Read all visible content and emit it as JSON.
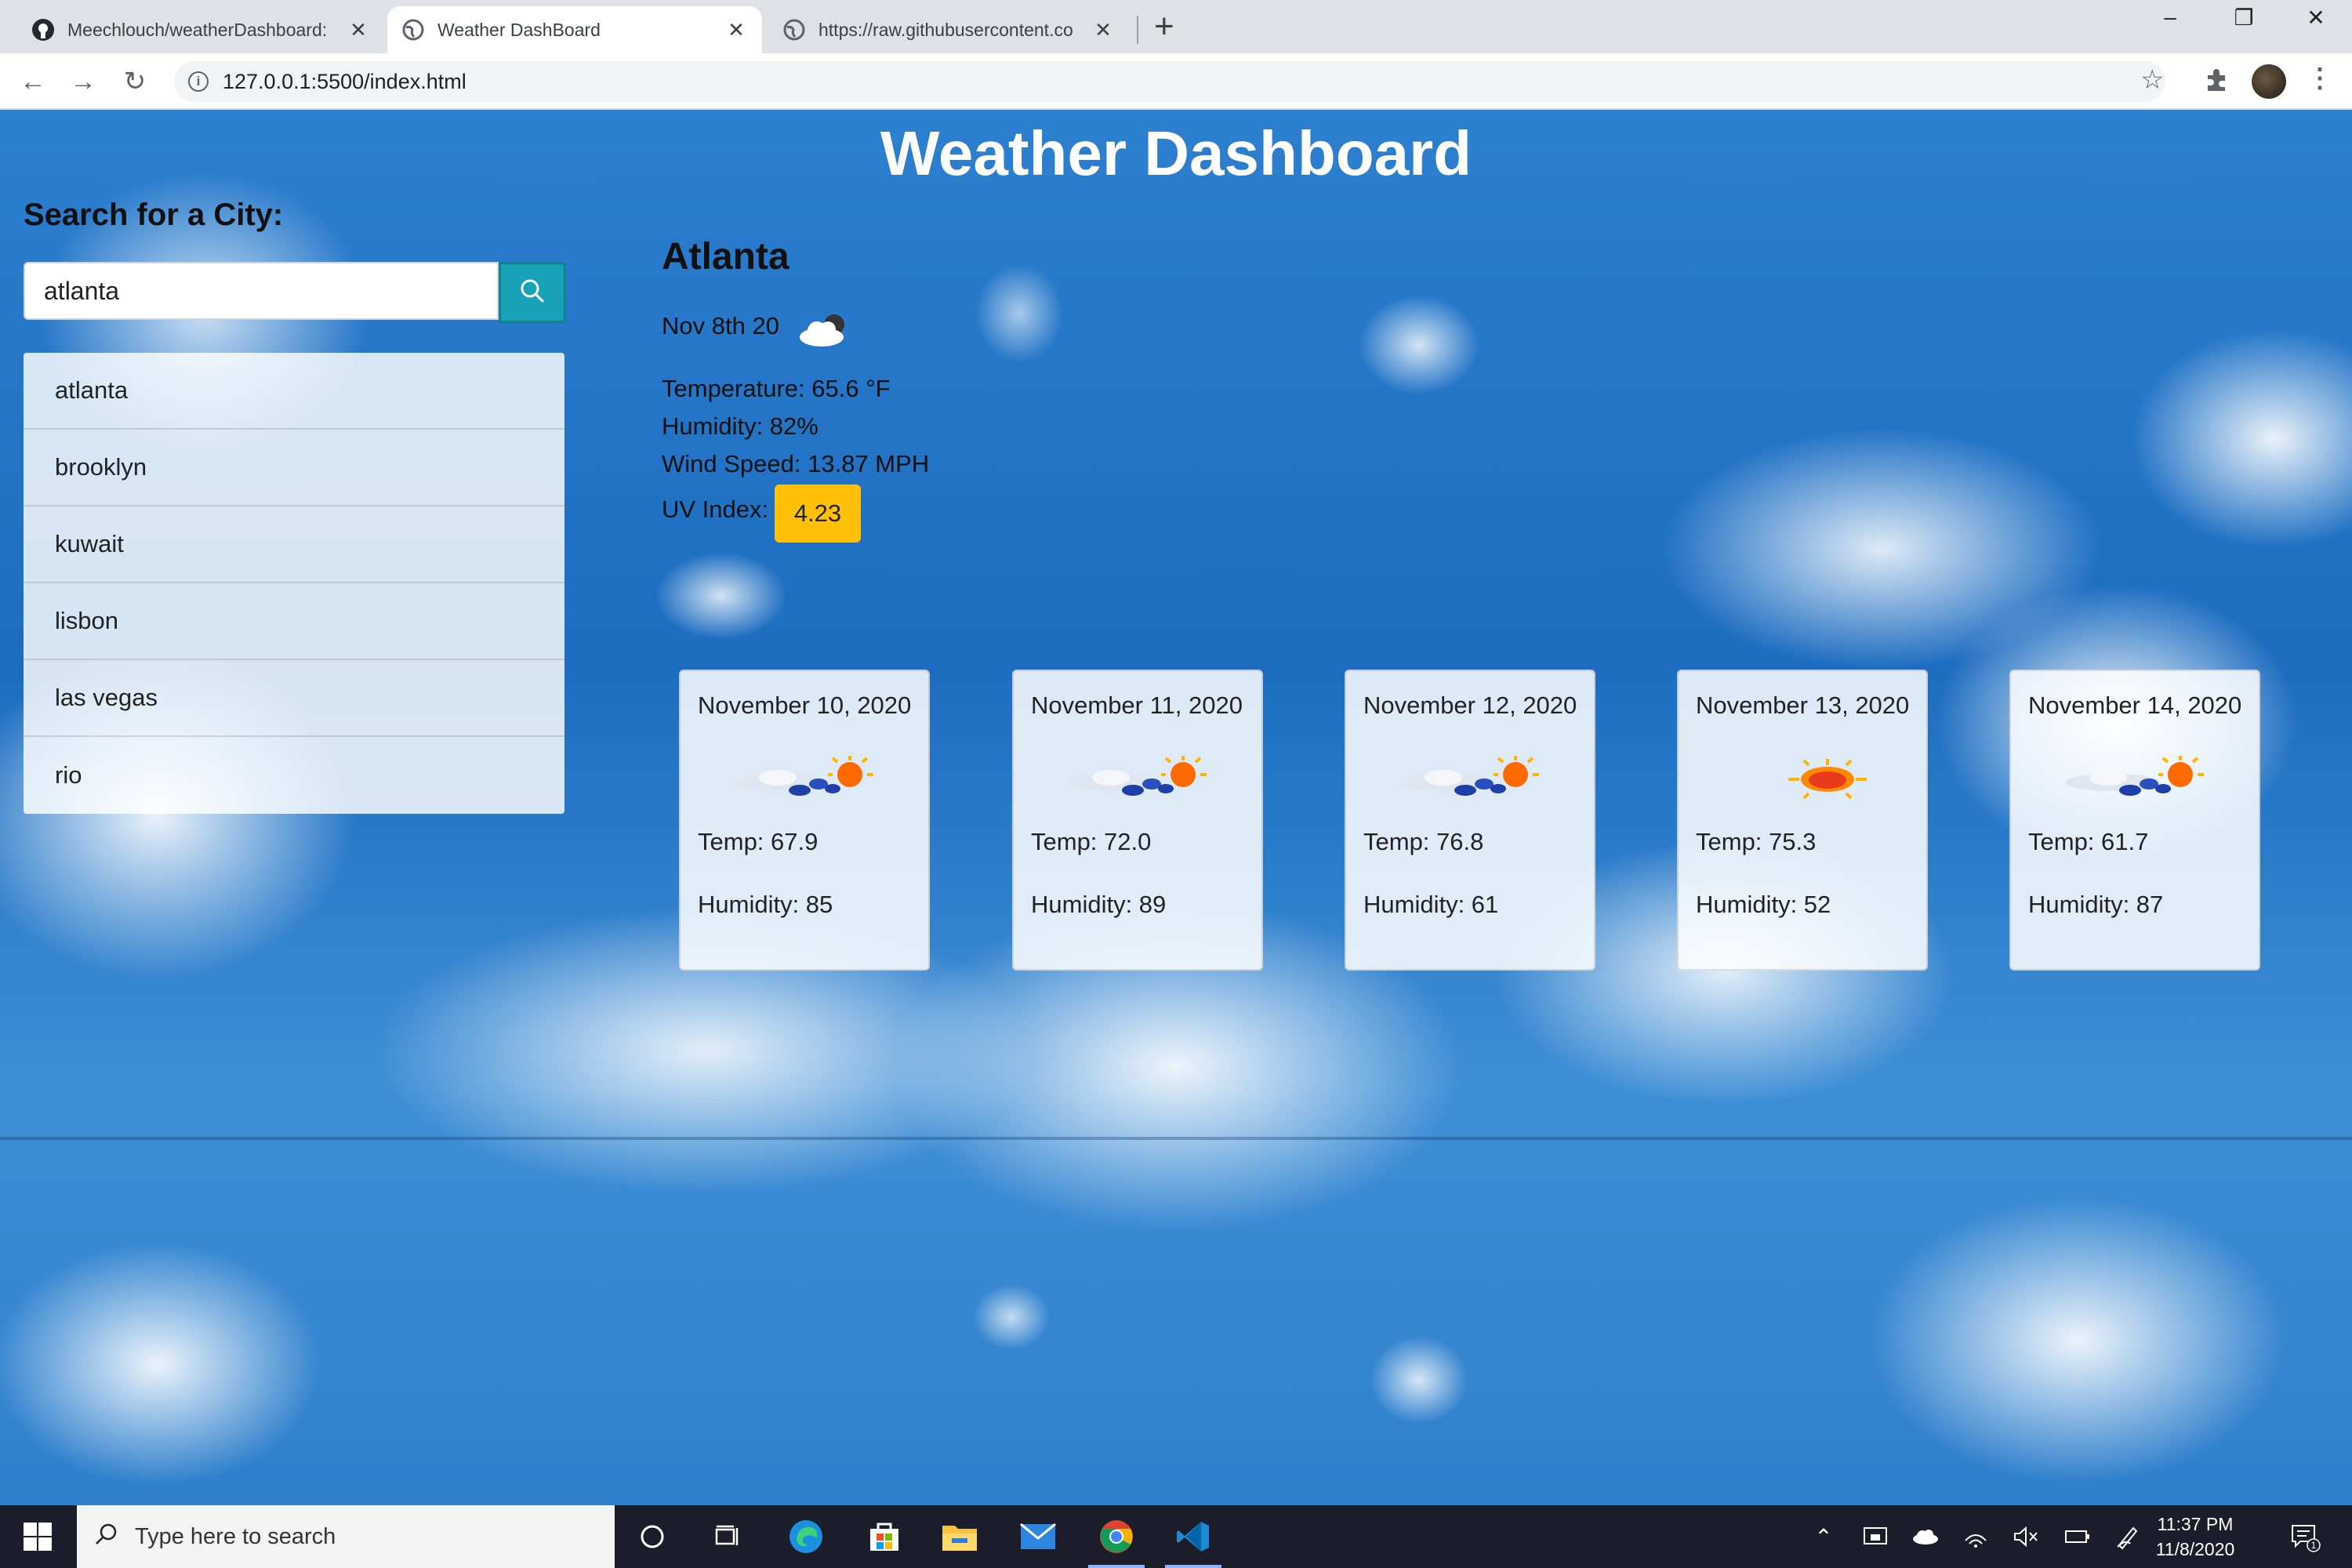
{
  "browser": {
    "tabs": [
      {
        "title": "Meechlouch/weatherDashboard:"
      },
      {
        "title": "Weather DashBoard"
      },
      {
        "title": "https://raw.githubusercontent.co"
      }
    ],
    "url": "127.0.0.1:5500/index.html"
  },
  "page": {
    "title": "Weather Dashboard",
    "search": {
      "label": "Search for a City:",
      "value": "atlanta"
    },
    "history": [
      "atlanta",
      "brooklyn",
      "kuwait",
      "lisbon",
      "las vegas",
      "rio"
    ],
    "current": {
      "city": "Atlanta",
      "date": "Nov 8th 20",
      "icon": "cloud-icon",
      "temperature": "Temperature: 65.6 °F",
      "humidity": "Humidity: 82%",
      "wind": "Wind Speed: 13.87 MPH",
      "uv_label": "UV Index:",
      "uv_value": "4.23",
      "uv_color": "#ffc107"
    },
    "forecast": [
      {
        "date": "November 10, 2020",
        "icon": "partly-cloudy-icon",
        "temp": "Temp: 67.9",
        "humidity": "Humidity: 85"
      },
      {
        "date": "November 11, 2020",
        "icon": "partly-cloudy-icon",
        "temp": "Temp: 72.0",
        "humidity": "Humidity: 89"
      },
      {
        "date": "November 12, 2020",
        "icon": "partly-cloudy-icon",
        "temp": "Temp: 76.8",
        "humidity": "Humidity: 61"
      },
      {
        "date": "November 13, 2020",
        "icon": "sun-icon",
        "temp": "Temp: 75.3",
        "humidity": "Humidity: 52"
      },
      {
        "date": "November 14, 2020",
        "icon": "partly-cloudy-icon",
        "temp": "Temp: 61.7",
        "humidity": "Humidity: 87"
      }
    ]
  },
  "taskbar": {
    "search_placeholder": "Type here to search",
    "time": "11:37 PM",
    "date": "11/8/2020",
    "notification_count": "1"
  }
}
